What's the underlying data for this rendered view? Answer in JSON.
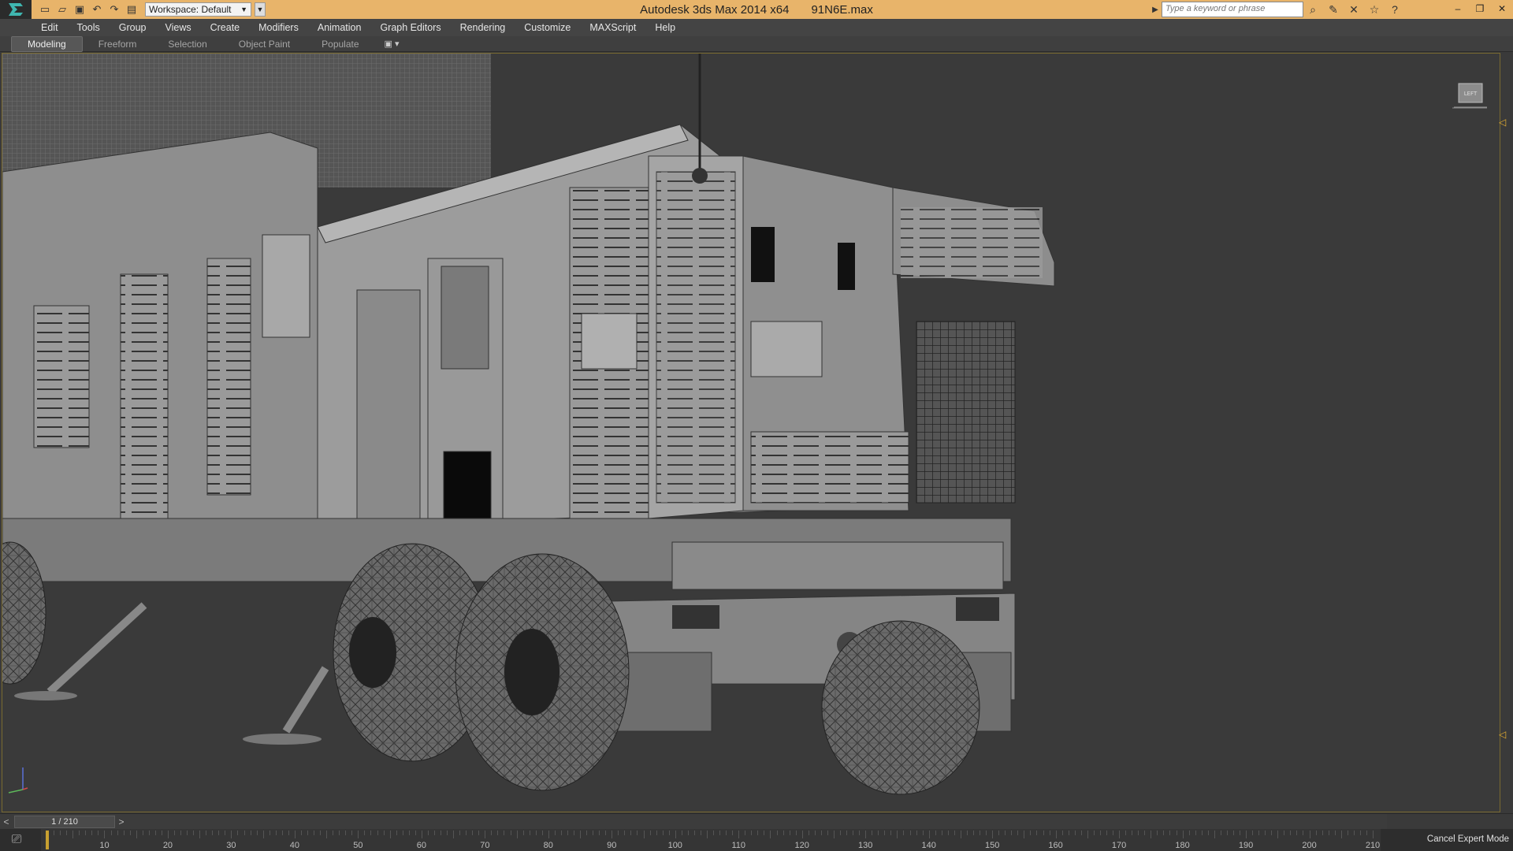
{
  "window": {
    "app_title": "Autodesk 3ds Max  2014 x64",
    "file_name": "91N6E.max",
    "workspace_label": "Workspace: Default",
    "search_placeholder": "Type a keyword or phrase"
  },
  "menu": {
    "items": [
      "Edit",
      "Tools",
      "Group",
      "Views",
      "Create",
      "Modifiers",
      "Animation",
      "Graph Editors",
      "Rendering",
      "Customize",
      "MAXScript",
      "Help"
    ]
  },
  "ribbon": {
    "tabs": [
      "Modeling",
      "Freeform",
      "Selection",
      "Object Paint",
      "Populate"
    ],
    "active_tab": "Modeling"
  },
  "viewport": {
    "viewcube_label": "LEFT"
  },
  "timeline": {
    "frame_readout": "1 / 210",
    "current_frame": 1,
    "total_frames": 210,
    "ticks": [
      10,
      20,
      30,
      40,
      50,
      60,
      70,
      80,
      90,
      100,
      110,
      120,
      130,
      140,
      150,
      160,
      170,
      180,
      190,
      200,
      210
    ]
  },
  "status": {
    "expert_button": "Cancel Expert Mode"
  },
  "icons": {
    "accent": "#e8b46a",
    "marker": "#c8a030"
  }
}
